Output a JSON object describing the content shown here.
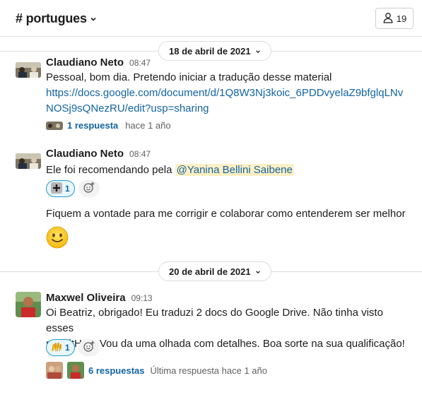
{
  "header": {
    "channel": "# portugues",
    "member_count": "19"
  },
  "dividers": [
    {
      "label": "18 de abril de 2021"
    },
    {
      "label": "20 de abril de 2021"
    }
  ],
  "messages": [
    {
      "sender": "Claudiano Neto",
      "time": "08:47",
      "text": "Pessoal, bom dia. Pretendo iniciar a tradução desse material",
      "link_line1": "https://docs.google.com/document/d/1Q8W3Nj3koic_6PDDvyelaZ9bfglqLNv",
      "link_line2": "NOSj9sQNezRU/edit?usp=sharing",
      "thread_count": "1 respuesta",
      "thread_ago": "hace 1 año"
    },
    {
      "sender": "Claudiano Neto",
      "time": "08:47",
      "text_before": "Ele foi recomendando pela ",
      "mention": "@Yanina Bellini Saibene",
      "reaction_emoji": "➕",
      "reaction_count": "1",
      "followup": "Fiquem a vontade para me corrigir e colaborar como entenderem ser melhor",
      "big_emoji": "slightly-smiling-face"
    },
    {
      "sender": "Maxwel Oliveira",
      "time": "09:13",
      "line1": "Oi Beatriz, obrigado! Eu traduzi 2 docs do Google Drive. Não tinha visto esses",
      "line2": "no GitHub. Vou da uma olhada com detalhes. Boa sorte na sua qualificação!",
      "reaction_emoji": "🙌",
      "reaction_count": "1",
      "thread_count": "6 respuestas",
      "thread_ago": "Última respuesta hace 1 año"
    }
  ],
  "colors": {
    "link": "#1264a3",
    "mention_bg": "#fdefc3",
    "reaction_bg": "#e8f5fa"
  }
}
